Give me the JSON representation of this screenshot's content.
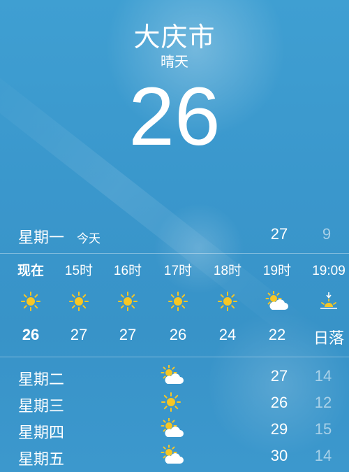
{
  "header": {
    "city": "大庆市",
    "condition": "晴天",
    "temperature": "26"
  },
  "today": {
    "day": "星期一",
    "tag": "今天",
    "high": "27",
    "low": "9"
  },
  "hourly": [
    {
      "time": "现在",
      "icon": "sun-icon",
      "temp": "26"
    },
    {
      "time": "15时",
      "icon": "sun-icon",
      "temp": "27"
    },
    {
      "time": "16时",
      "icon": "sun-icon",
      "temp": "27"
    },
    {
      "time": "17时",
      "icon": "sun-icon",
      "temp": "26"
    },
    {
      "time": "18时",
      "icon": "sun-icon",
      "temp": "24"
    },
    {
      "time": "19时",
      "icon": "partly-cloudy-icon",
      "temp": "22"
    },
    {
      "time": "19:09",
      "icon": "sunset-icon",
      "temp": "日落"
    }
  ],
  "daily": [
    {
      "day": "星期二",
      "icon": "partly-cloudy-icon",
      "high": "27",
      "low": "14"
    },
    {
      "day": "星期三",
      "icon": "sun-icon",
      "high": "26",
      "low": "12"
    },
    {
      "day": "星期四",
      "icon": "partly-cloudy-icon",
      "high": "29",
      "low": "15"
    },
    {
      "day": "星期五",
      "icon": "partly-cloudy-icon",
      "high": "30",
      "low": "14"
    }
  ],
  "colors": {
    "background": "#3a97cc",
    "sun": "#f7c624",
    "cloud": "#ffffff"
  }
}
